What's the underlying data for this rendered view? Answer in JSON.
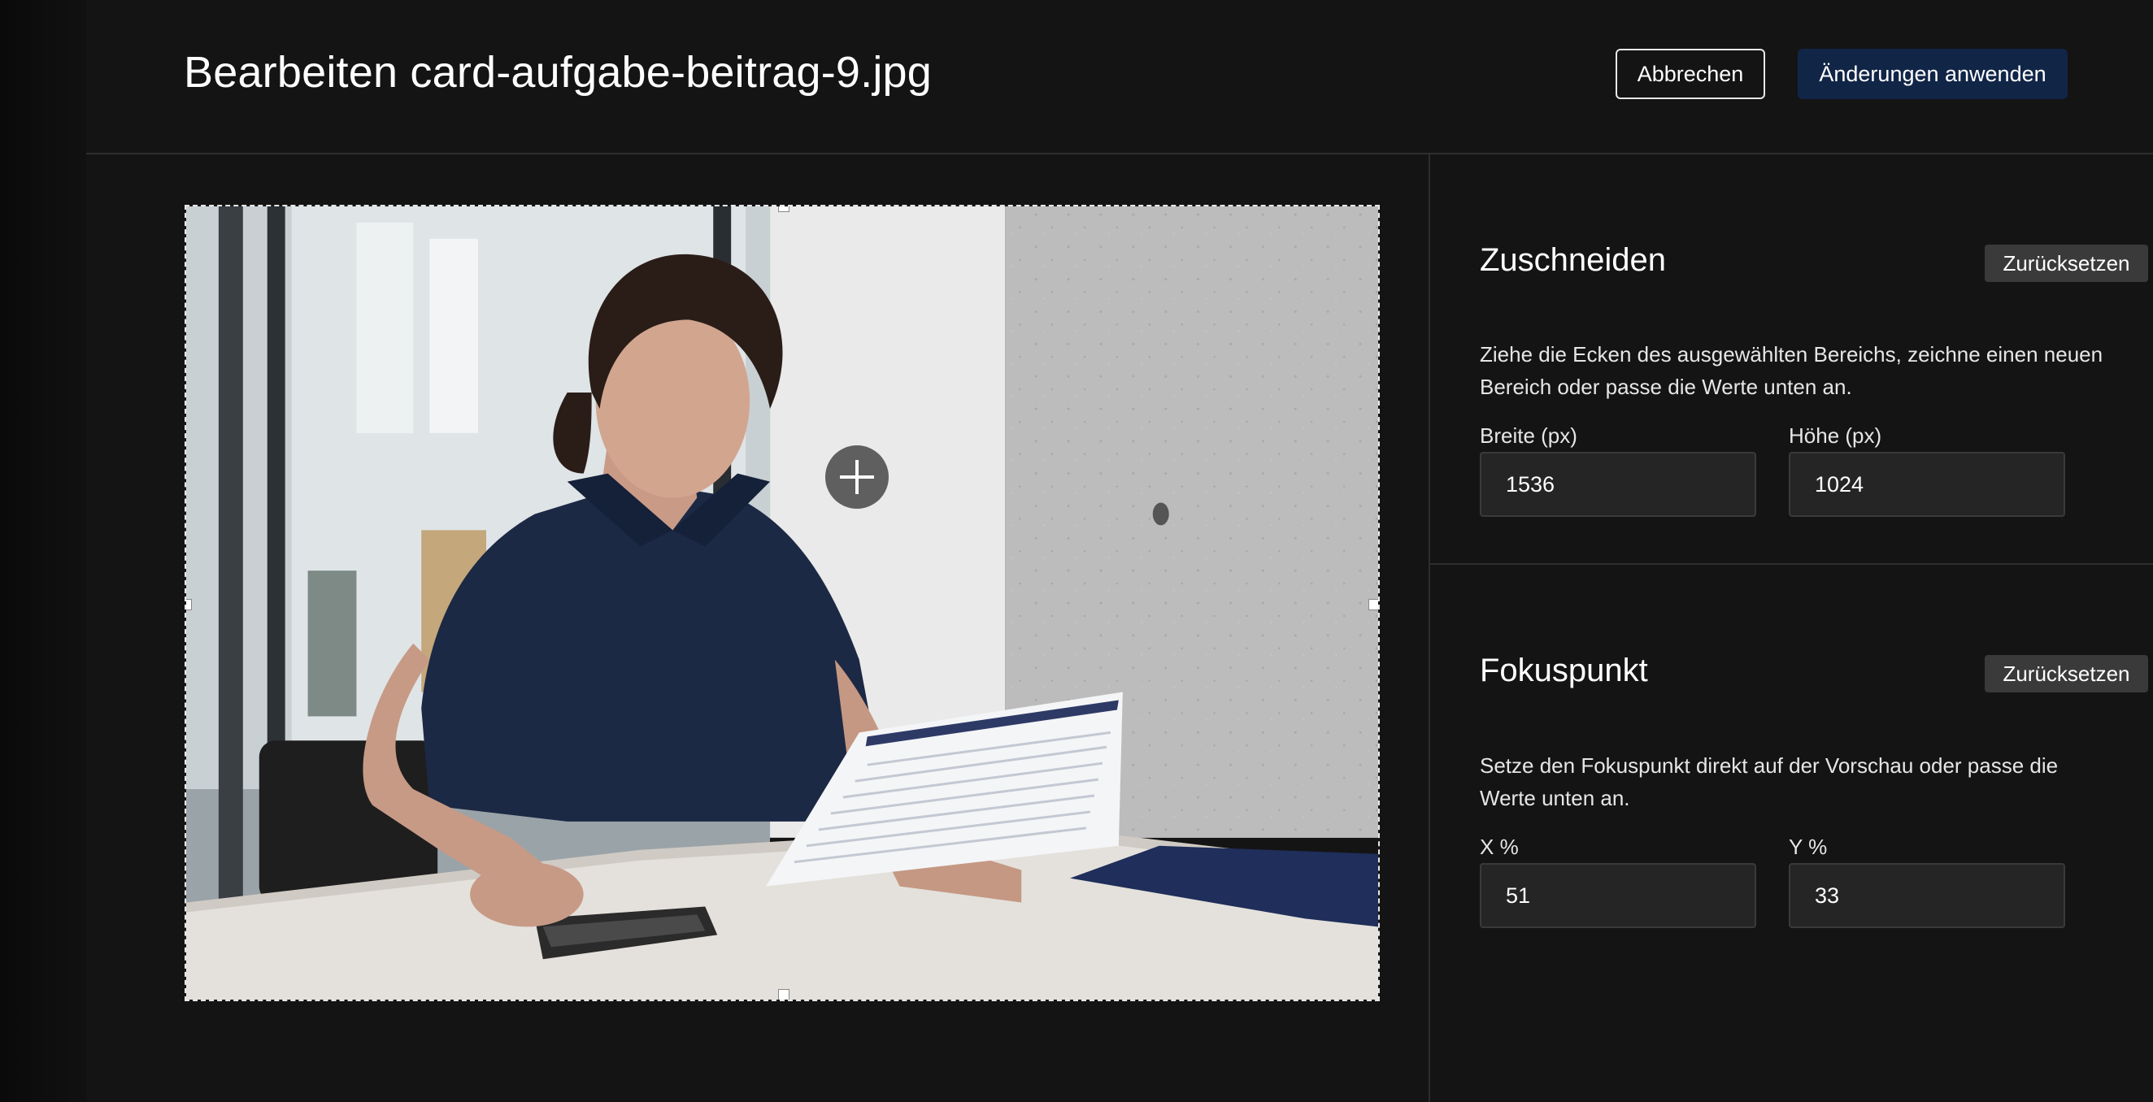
{
  "header": {
    "title": "Bearbeiten card-aufgabe-beitrag-9.jpg",
    "cancel_label": "Abbrechen",
    "apply_label": "Änderungen anwenden",
    "apply_color": "#112547"
  },
  "crop": {
    "title": "Zuschneiden",
    "reset_label": "Zurücksetzen",
    "description": "Ziehe die Ecken des ausgewählten Bereichs, zeichne einen neuen Bereich oder passe die Werte unten an.",
    "width_label": "Breite (px)",
    "width_value": "1536",
    "height_label": "Höhe (px)",
    "height_value": "1024"
  },
  "focus": {
    "title": "Fokuspunkt",
    "reset_label": "Zurücksetzen",
    "description": "Setze den Fokuspunkt direkt auf der Vorschau oder passe die Werte unten an.",
    "x_label": "X %",
    "x_value": "51",
    "y_label": "Y %",
    "y_value": "33",
    "marker_icon": "plus-icon"
  }
}
